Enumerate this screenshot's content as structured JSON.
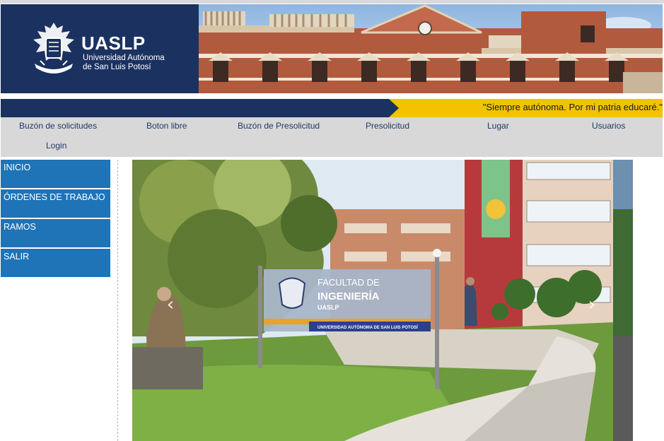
{
  "header": {
    "logo_title": "UASLP",
    "logo_subtitle_line1": "Universidad Autónoma",
    "logo_subtitle_line2": "de San Luis Potosí",
    "motto": "\"Siempre autónoma. Por mi patria educaré.\""
  },
  "nav": {
    "items": [
      {
        "label": "Buzón de solicitudes"
      },
      {
        "label": "Boton libre"
      },
      {
        "label": "Buzón de Presolicitud"
      },
      {
        "label": "Presolicitud"
      },
      {
        "label": "Lugar"
      },
      {
        "label": "Usuarios"
      },
      {
        "label": "Login"
      }
    ]
  },
  "sidebar": {
    "items": [
      {
        "label": "INICIO"
      },
      {
        "label": "ÓRDENES DE TRABAJO"
      },
      {
        "label": "RAMOS"
      },
      {
        "label": "SALIR"
      }
    ]
  },
  "carousel": {
    "sign_line1": "FACULTAD DE",
    "sign_line2": "INGENIERÍA",
    "sign_line3": "UASLP",
    "sign_footer": "UNIVERSIDAD AUTÓNOMA DE SAN LUIS POTOSÍ",
    "prev_icon": "chevron-left-icon",
    "next_icon": "chevron-right-icon"
  },
  "colors": {
    "brand_navy": "#1b3160",
    "accent_yellow": "#f3c200",
    "sidebar_blue": "#1f73b7",
    "nav_gray": "#d8d8d8"
  }
}
